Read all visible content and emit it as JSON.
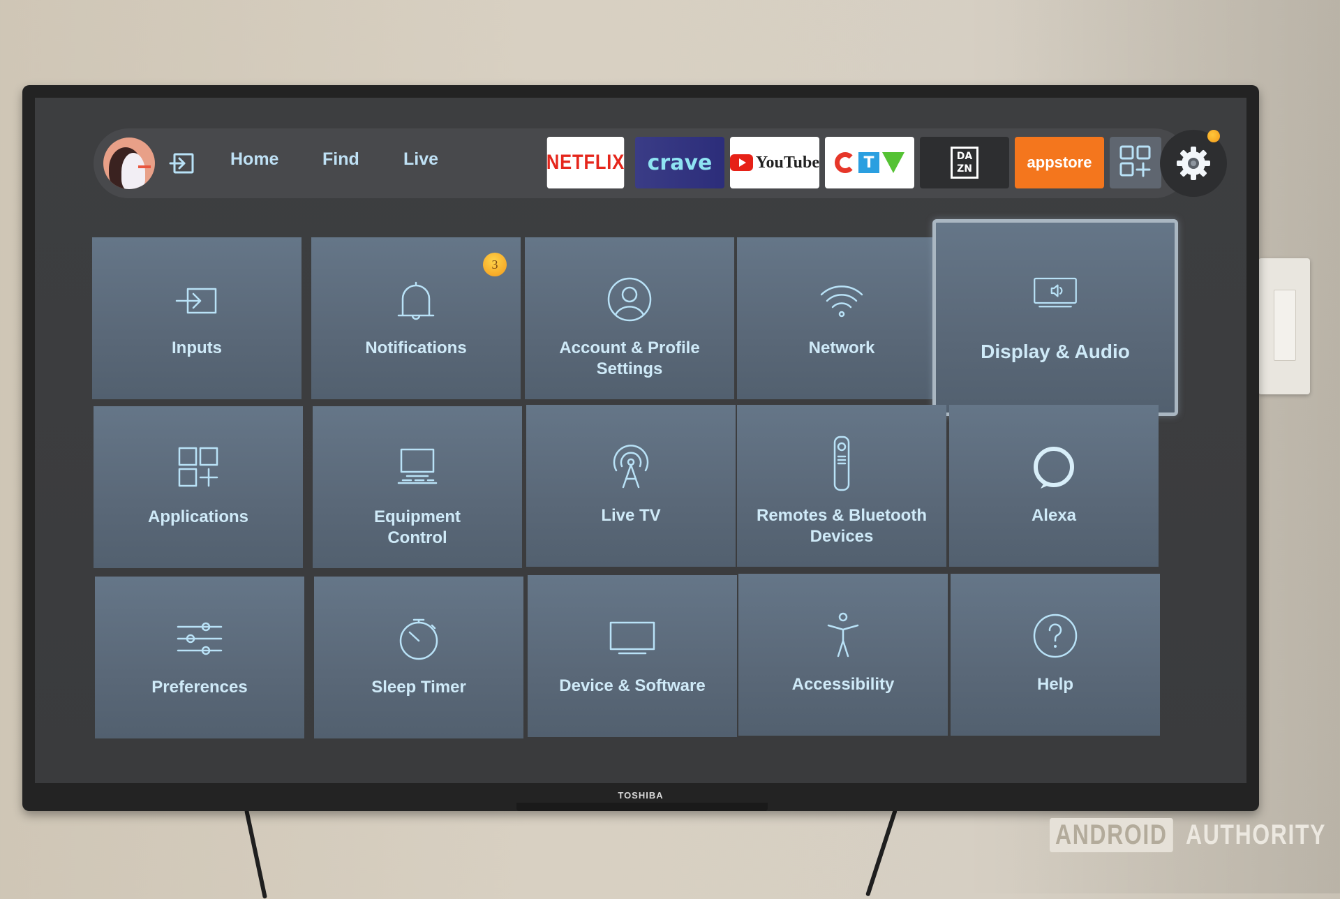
{
  "tv": {
    "brand": "TOSHIBA"
  },
  "navbar": {
    "items": [
      {
        "label": "Home"
      },
      {
        "label": "Find"
      },
      {
        "label": "Live"
      }
    ],
    "apps": {
      "netflix": "NETFLIX",
      "crave": "crave",
      "youtube": "YouTube",
      "ctv_t": "T",
      "dazn": "DA\nZN",
      "appstore": "appstore"
    },
    "settings_notification": true
  },
  "settings_grid": [
    {
      "label": "Inputs",
      "icon": "input-icon"
    },
    {
      "label": "Notifications",
      "icon": "bell-icon",
      "badge": "3"
    },
    {
      "label": "Account & Profile Settings",
      "icon": "profile-icon"
    },
    {
      "label": "Network",
      "icon": "wifi-icon"
    },
    {
      "label": "Display & Audio",
      "icon": "display-audio-icon",
      "focused": true
    },
    {
      "label": "Applications",
      "icon": "apps-icon"
    },
    {
      "label": "Equipment Control",
      "icon": "equipment-icon"
    },
    {
      "label": "Live TV",
      "icon": "antenna-icon"
    },
    {
      "label": "Remotes & Bluetooth Devices",
      "icon": "remote-icon"
    },
    {
      "label": "Alexa",
      "icon": "alexa-icon"
    },
    {
      "label": "Preferences",
      "icon": "sliders-icon"
    },
    {
      "label": "Sleep Timer",
      "icon": "timer-icon"
    },
    {
      "label": "Device & Software",
      "icon": "monitor-icon"
    },
    {
      "label": "Accessibility",
      "icon": "accessibility-icon"
    },
    {
      "label": "Help",
      "icon": "help-icon"
    }
  ],
  "watermark": {
    "boxed": "ANDROID",
    "text": "AUTHORITY"
  },
  "colors": {
    "accent_text": "#bfe1f5",
    "tile": "#5f6e7e",
    "appstore": "#f4761d",
    "badge": "#f7b52c"
  }
}
